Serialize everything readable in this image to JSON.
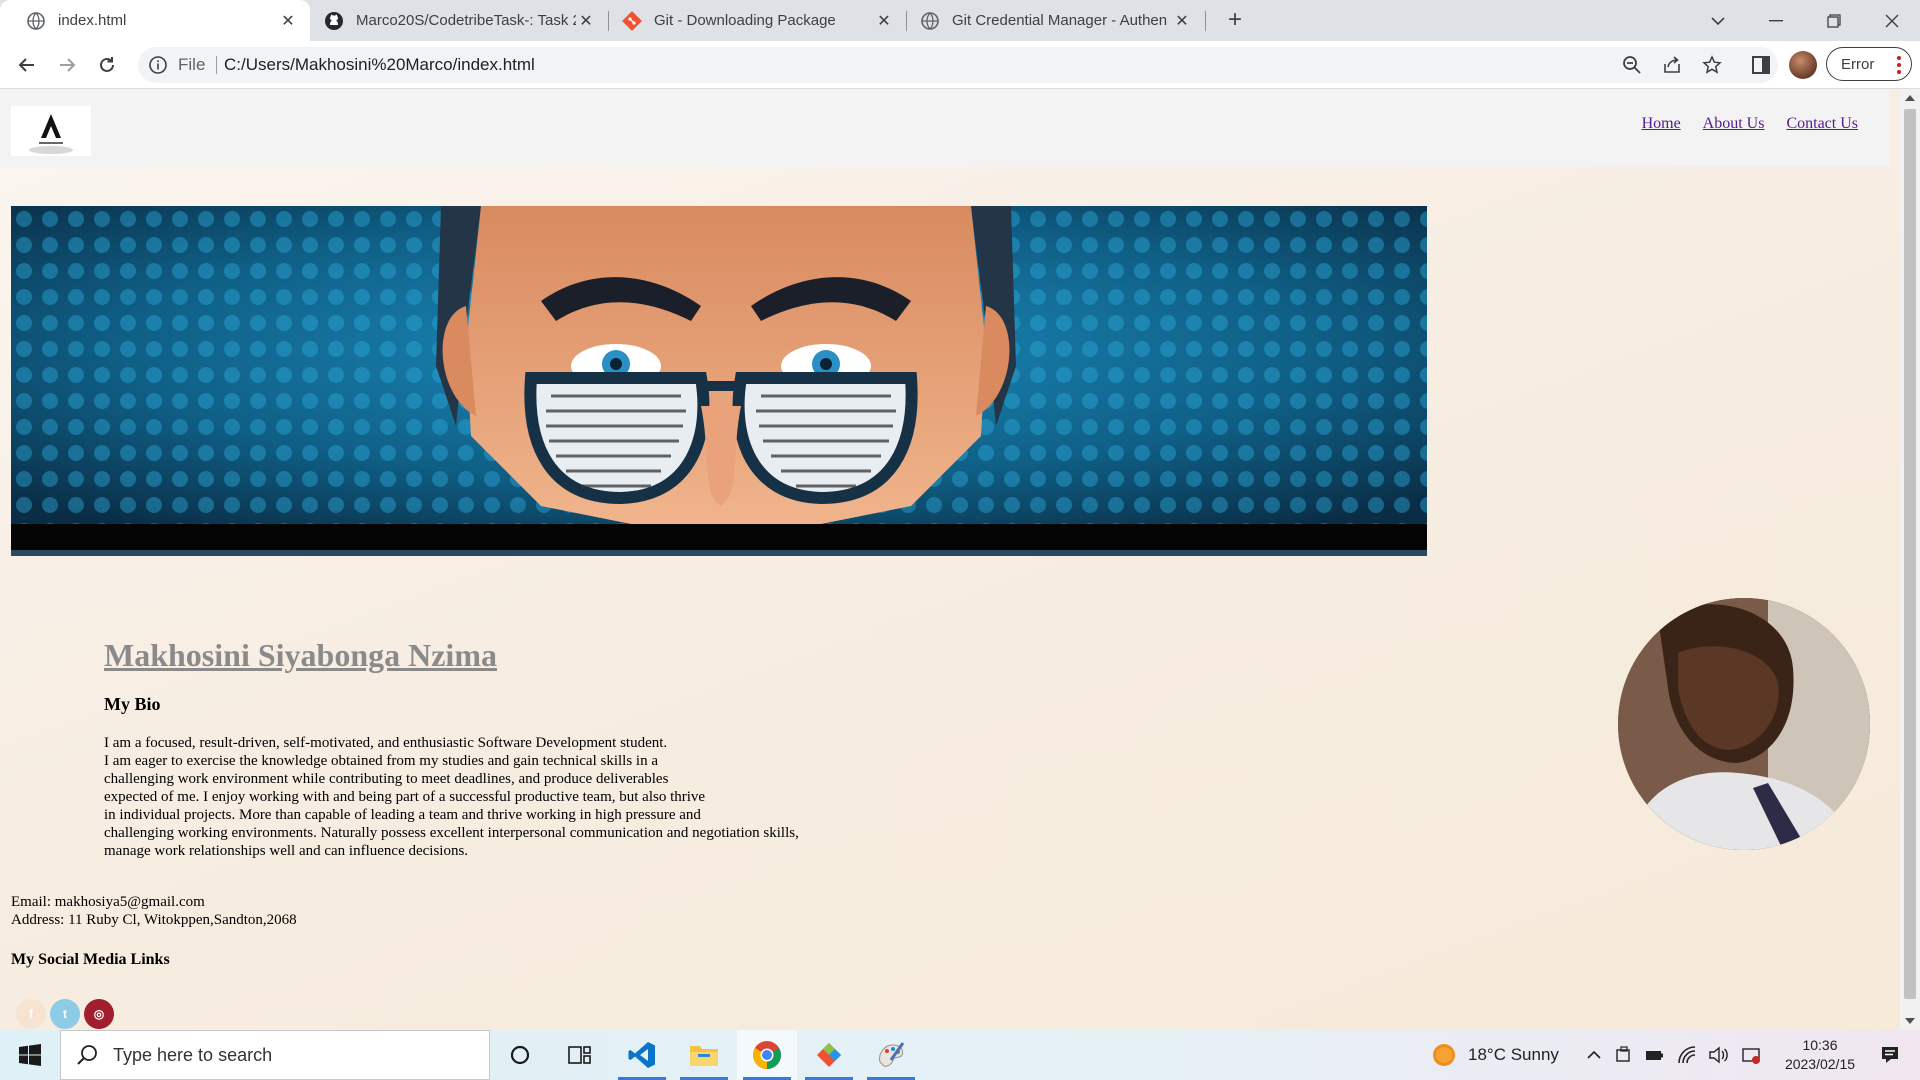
{
  "browser": {
    "tabs": [
      {
        "title": "index.html",
        "icon": "globe-icon",
        "active": true
      },
      {
        "title": "Marco20S/CodetribeTask-: Task 2",
        "icon": "github-icon",
        "active": false
      },
      {
        "title": "Git - Downloading Package",
        "icon": "git-icon",
        "active": false
      },
      {
        "title": "Git Credential Manager - Authen",
        "icon": "globe-icon",
        "active": false
      }
    ],
    "omnibox": {
      "scheme_label": "File",
      "url": "C:/Users/Makhosini%20Marco/index.html"
    },
    "profile_button": "Error"
  },
  "page": {
    "nav": {
      "home": "Home",
      "about": "About Us",
      "contact": "Contact Us"
    },
    "name": "Makhosini Siyabonga Nzima",
    "bio_heading": "My Bio",
    "bio_text": "I am a focused, result-driven, self-motivated, and enthusiastic Software Development student.\nI am eager to exercise the knowledge obtained from my studies and gain technical skills in a\nchallenging work environment while contributing to meet deadlines, and produce deliverables\nexpected of me. I enjoy working with and being part of a successful productive team, but also thrive\nin individual projects. More than capable of leading a team and thrive working in high pressure and\nchallenging working environments. Naturally possess excellent interpersonal communication and negotiation skills,\nmanage work relationships well and can influence decisions.",
    "email": "Email: makhosiya5@gmail.com",
    "address": "Address: 11 Ruby Cl, Witokppen,Sandton,2068",
    "social_heading": "My Social Media Links",
    "social": [
      {
        "name": "facebook-icon",
        "glyph": "f",
        "color": "#f6e3d0"
      },
      {
        "name": "twitter-icon",
        "glyph": "t",
        "color": "#8ecbe6"
      },
      {
        "name": "instagram-icon",
        "glyph": "◎",
        "color": "#a11f2c"
      }
    ]
  },
  "taskbar": {
    "search_placeholder": "Type here to search",
    "weather": "18°C  Sunny",
    "time": "10:36",
    "date": "2023/02/15"
  }
}
